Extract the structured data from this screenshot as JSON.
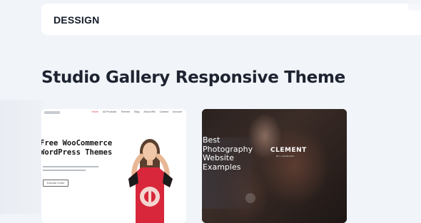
{
  "header": {
    "brand": "DESSIGN"
  },
  "main": {
    "heading": "Studio Gallery Responsive Theme"
  },
  "cards": [
    {
      "nav_links": [
        "Home",
        "All Products",
        "Themes",
        "Blog",
        "About WB",
        "Contact",
        "Account"
      ],
      "title_lines": [
        "Free WooCommerce",
        "WordPress Themes"
      ],
      "button_label": "EXPLORE STORE"
    },
    {
      "text_lines": [
        "Best",
        "Photography",
        "Website",
        "Examples"
      ],
      "logo_text": "CLEMENT",
      "logo_sub": "film + portrait artist"
    }
  ]
}
